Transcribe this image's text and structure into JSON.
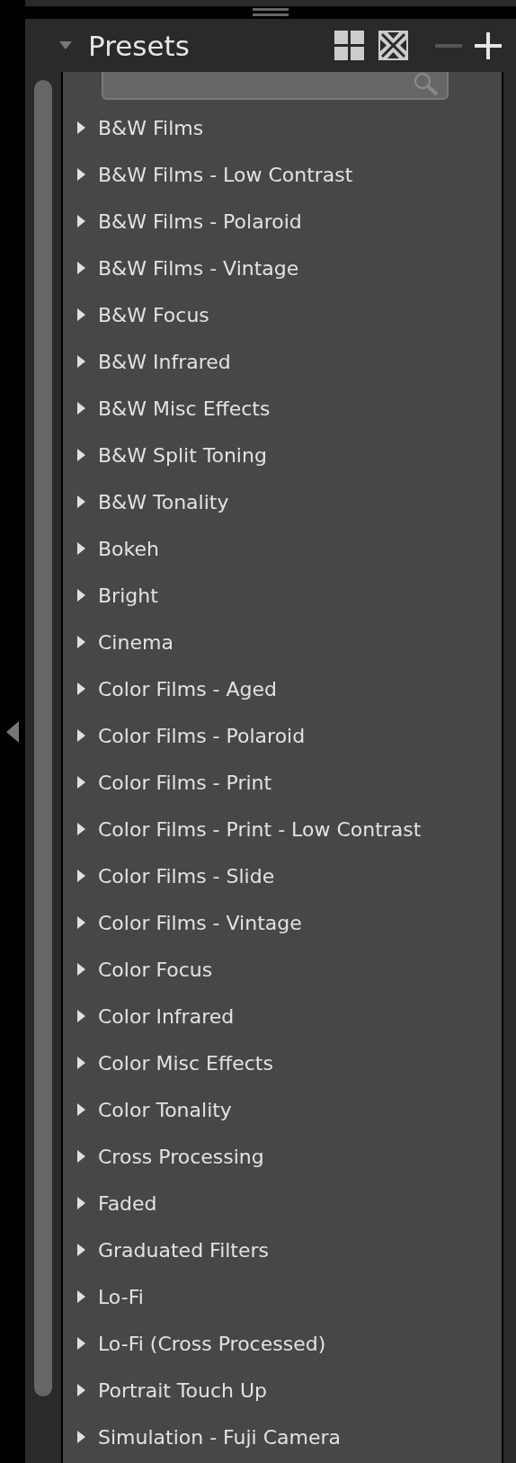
{
  "panel": {
    "title": "Presets",
    "expanded": true
  },
  "presets": [
    {
      "label": "B&W Films",
      "expanded": false
    },
    {
      "label": "B&W Films - Low Contrast",
      "expanded": false
    },
    {
      "label": "B&W Films - Polaroid",
      "expanded": false
    },
    {
      "label": "B&W Films - Vintage",
      "expanded": false
    },
    {
      "label": "B&W Focus",
      "expanded": false
    },
    {
      "label": "B&W Infrared",
      "expanded": false
    },
    {
      "label": "B&W Misc Effects",
      "expanded": false
    },
    {
      "label": "B&W Split Toning",
      "expanded": false
    },
    {
      "label": "B&W Tonality",
      "expanded": false
    },
    {
      "label": "Bokeh",
      "expanded": false
    },
    {
      "label": "Bright",
      "expanded": false
    },
    {
      "label": "Cinema",
      "expanded": false
    },
    {
      "label": "Color Films - Aged",
      "expanded": false
    },
    {
      "label": "Color Films - Polaroid",
      "expanded": false
    },
    {
      "label": "Color Films - Print",
      "expanded": false
    },
    {
      "label": "Color Films - Print - Low Contrast",
      "expanded": false
    },
    {
      "label": "Color Films - Slide",
      "expanded": false
    },
    {
      "label": "Color Films - Vintage",
      "expanded": false
    },
    {
      "label": "Color Focus",
      "expanded": false
    },
    {
      "label": "Color Infrared",
      "expanded": false
    },
    {
      "label": "Color Misc Effects",
      "expanded": false
    },
    {
      "label": "Color Tonality",
      "expanded": false
    },
    {
      "label": "Cross Processing",
      "expanded": false
    },
    {
      "label": "Faded",
      "expanded": false
    },
    {
      "label": "Graduated Filters",
      "expanded": false
    },
    {
      "label": "Lo-Fi",
      "expanded": false
    },
    {
      "label": "Lo-Fi (Cross Processed)",
      "expanded": false
    },
    {
      "label": "Portrait Touch Up",
      "expanded": false
    },
    {
      "label": "Simulation - Fuji Camera",
      "expanded": false
    }
  ]
}
